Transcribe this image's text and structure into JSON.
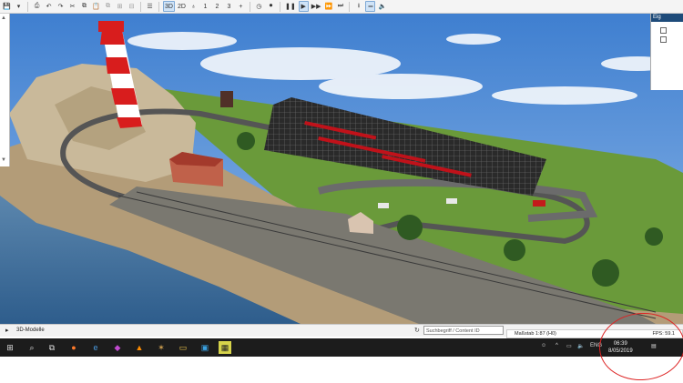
{
  "toolbar": {
    "view_3d_label": "3D",
    "view_2d_label": "2D",
    "layer_1": "1",
    "layer_2": "2",
    "layer_3": "3"
  },
  "right_panel": {
    "header": "Eig"
  },
  "bottom_panel": {
    "label": "3D-Modelle",
    "search_placeholder": "Suchbegriff / Content ID"
  },
  "status": {
    "scale": "Maßstab 1:87 (H0)",
    "fps": "FPS: 59.1"
  },
  "taskbar": {
    "language": "ENG",
    "time": "06:39",
    "date": "8/05/2019"
  },
  "colors": {
    "sky": "#5a8fd0",
    "grass": "#6a9a3a",
    "water": "#3f6f9e",
    "taskbar": "#1c1c1c",
    "annotation": "#dd2222"
  }
}
